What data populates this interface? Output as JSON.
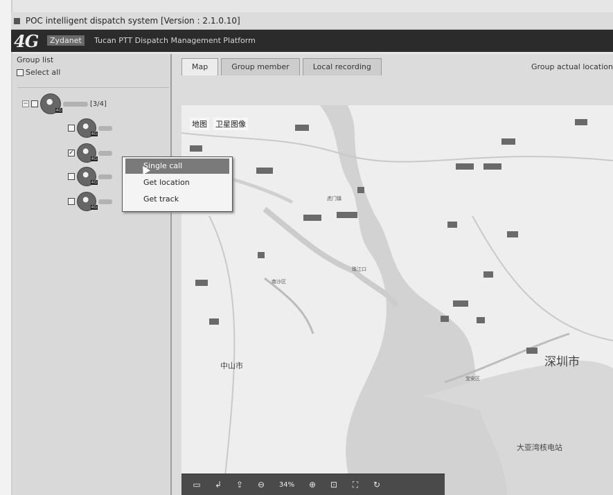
{
  "window": {
    "title": "POC intelligent dispatch system [Version : 2.1.0.10]"
  },
  "brand": {
    "logo": "4G",
    "name": "Zydanet",
    "platform": "Tucan PTT Dispatch Management Platform"
  },
  "left_panel": {
    "group_list_label": "Group list",
    "select_all_label": "Select all",
    "root_group_count": "[3/4]"
  },
  "context_menu": {
    "items": [
      {
        "label": "Single call"
      },
      {
        "label": "Get location"
      },
      {
        "label": "Get track"
      }
    ]
  },
  "tabs": [
    {
      "label": "Map"
    },
    {
      "label": "Group member"
    },
    {
      "label": "Local recording"
    }
  ],
  "group_location_label": "Group actual location",
  "map": {
    "type_buttons": [
      "地图",
      "卫星图像"
    ],
    "labels": {
      "zhongshan": "中山市",
      "shenzhen": "深圳市",
      "dayawan": "大亚湾核电站",
      "zhujiang": "珠江口",
      "bao": "宝安区",
      "nansha": "南沙区",
      "humen": "虎门镇"
    }
  },
  "toolbar": {
    "zoom_level": "34%"
  },
  "colors": {
    "brand_bar": "#2b2b2b",
    "highlight": "#7a7a7a",
    "toolbar": "#4a4a4a"
  }
}
